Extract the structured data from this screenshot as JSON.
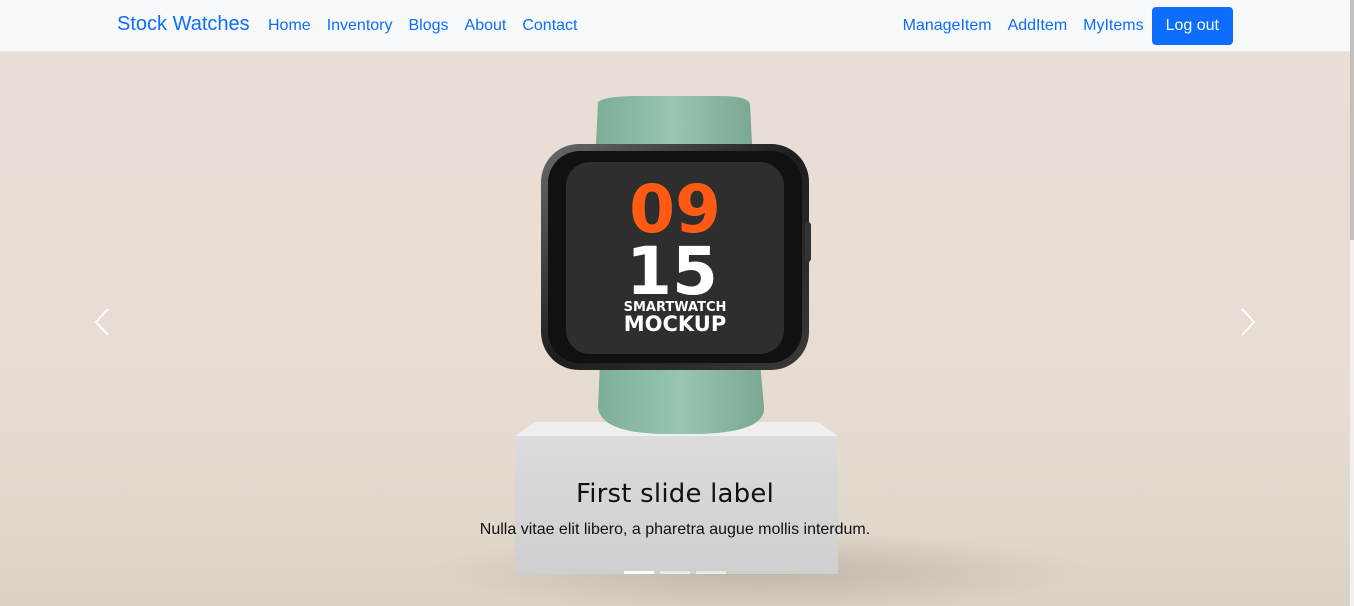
{
  "navbar": {
    "brand": "Stock Watches",
    "left_links": [
      "Home",
      "Inventory",
      "Blogs",
      "About",
      "Contact"
    ],
    "right_links": [
      "ManageItem",
      "AddItem",
      "MyItems"
    ],
    "logout_label": "Log out"
  },
  "carousel": {
    "slide_count": 3,
    "active_index": 0,
    "image_text": {
      "hour": "09",
      "minute": "15",
      "line1": "SMARTWATCH",
      "line2": "MOCKUP"
    },
    "caption": {
      "title": "First slide label",
      "text": "Nulla vitae elit libero, a pharetra augue mollis interdum."
    },
    "icons": {
      "prev": "chevron-left-icon",
      "next": "chevron-right-icon"
    }
  },
  "colors": {
    "primary": "#0d6efd",
    "navbar_bg": "#f8f9fa",
    "slide_bg": "#e9dfd6",
    "watch_band": "#8fbfa9",
    "watch_screen": "#2e2e2e",
    "hour_color": "#ff5a14"
  }
}
